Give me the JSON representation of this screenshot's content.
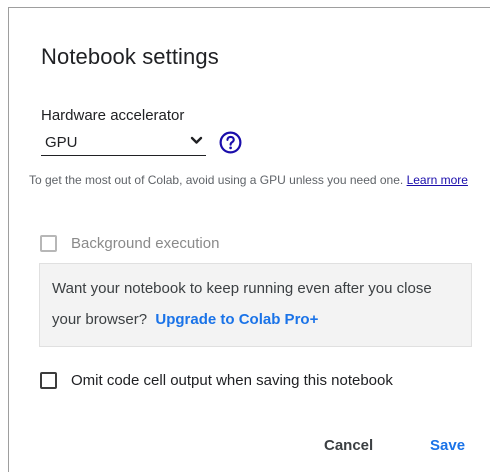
{
  "dialog": {
    "title": "Notebook settings"
  },
  "hardware": {
    "label": "Hardware accelerator",
    "selected": "GPU",
    "help_icon": "help-circle-icon",
    "caret_icon": "chevron-down-icon"
  },
  "info": {
    "text": "To get the most out of Colab, avoid using a GPU unless you need one.",
    "link": "Learn more"
  },
  "background_execution": {
    "label": "Background execution",
    "checked": false,
    "disabled": true,
    "promo_text": "Want your notebook to keep running even after you close your browser?",
    "promo_link": "Upgrade to Colab Pro+"
  },
  "omit_output": {
    "label": "Omit code cell output when saving this notebook",
    "checked": false
  },
  "buttons": {
    "cancel": "Cancel",
    "save": "Save"
  },
  "colors": {
    "accent": "#1a73e8",
    "link": "#1a0dab",
    "help_icon": "#1a0dab",
    "promo_background": "#f3f3f3"
  }
}
